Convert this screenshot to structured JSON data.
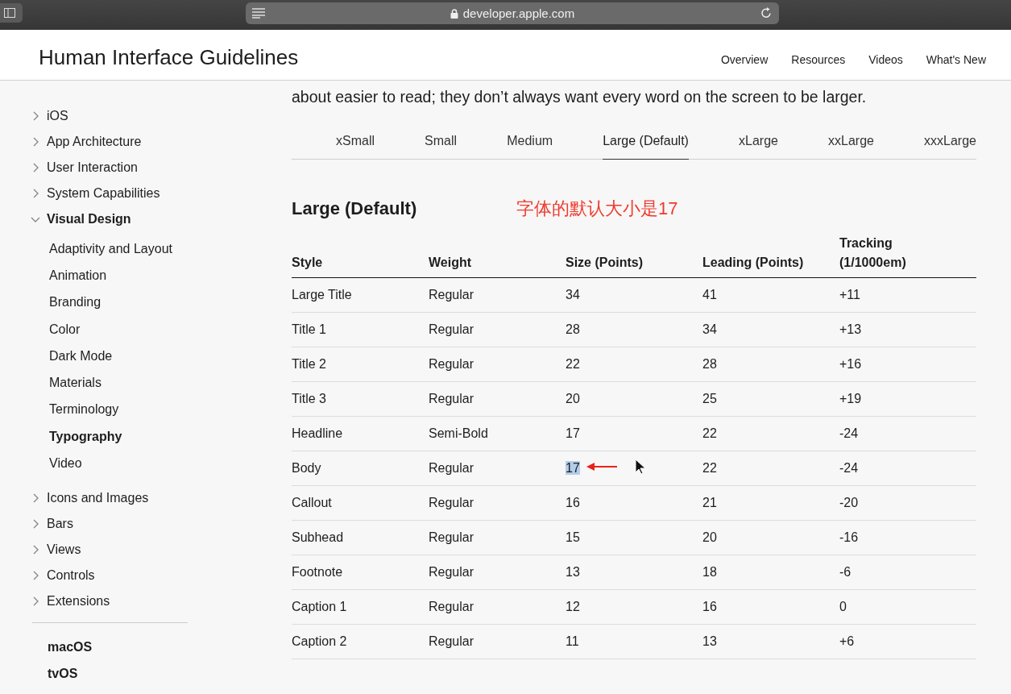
{
  "browser": {
    "address": "developer.apple.com"
  },
  "header": {
    "title": "Human Interface Guidelines",
    "nav": [
      "Overview",
      "Resources",
      "Videos",
      "What's New"
    ]
  },
  "sidebar": {
    "items": [
      {
        "label": "iOS",
        "expanded": false
      },
      {
        "label": "App Architecture",
        "expanded": false
      },
      {
        "label": "User Interaction",
        "expanded": false
      },
      {
        "label": "System Capabilities",
        "expanded": false
      },
      {
        "label": "Visual Design",
        "expanded": true,
        "children": [
          {
            "label": "Adaptivity and Layout",
            "selected": false
          },
          {
            "label": "Animation",
            "selected": false
          },
          {
            "label": "Branding",
            "selected": false
          },
          {
            "label": "Color",
            "selected": false
          },
          {
            "label": "Dark Mode",
            "selected": false
          },
          {
            "label": "Materials",
            "selected": false
          },
          {
            "label": "Terminology",
            "selected": false
          },
          {
            "label": "Typography",
            "selected": true
          },
          {
            "label": "Video",
            "selected": false
          }
        ]
      },
      {
        "label": "Icons and Images",
        "expanded": false
      },
      {
        "label": "Bars",
        "expanded": false
      },
      {
        "label": "Views",
        "expanded": false
      },
      {
        "label": "Controls",
        "expanded": false
      },
      {
        "label": "Extensions",
        "expanded": false
      }
    ],
    "platforms": [
      "macOS",
      "tvOS"
    ]
  },
  "intro": "about easier to read; they don’t always want every word on the screen to be larger.",
  "tabs": [
    {
      "label": "xSmall",
      "selected": false
    },
    {
      "label": "Small",
      "selected": false
    },
    {
      "label": "Medium",
      "selected": false
    },
    {
      "label": "Large (Default)",
      "selected": true
    },
    {
      "label": "xLarge",
      "selected": false
    },
    {
      "label": "xxLarge",
      "selected": false
    },
    {
      "label": "xxxLarge",
      "selected": false
    }
  ],
  "section_title": "Large (Default)",
  "annotation": "字体的默认大小是17",
  "table": {
    "columns": [
      "Style",
      "Weight",
      "Size (Points)",
      "Leading (Points)",
      "Tracking (1/1000em)"
    ],
    "rows": [
      {
        "cells": [
          "Large Title",
          "Regular",
          "34",
          "41",
          "+11"
        ],
        "size_highlighted": false
      },
      {
        "cells": [
          "Title 1",
          "Regular",
          "28",
          "34",
          "+13"
        ],
        "size_highlighted": false
      },
      {
        "cells": [
          "Title 2",
          "Regular",
          "22",
          "28",
          "+16"
        ],
        "size_highlighted": false
      },
      {
        "cells": [
          "Title 3",
          "Regular",
          "20",
          "25",
          "+19"
        ],
        "size_highlighted": false
      },
      {
        "cells": [
          "Headline",
          "Semi-Bold",
          "17",
          "22",
          "-24"
        ],
        "size_highlighted": false
      },
      {
        "cells": [
          "Body",
          "Regular",
          "17",
          "22",
          "-24"
        ],
        "size_highlighted": true
      },
      {
        "cells": [
          "Callout",
          "Regular",
          "16",
          "21",
          "-20"
        ],
        "size_highlighted": false
      },
      {
        "cells": [
          "Subhead",
          "Regular",
          "15",
          "20",
          "-16"
        ],
        "size_highlighted": false
      },
      {
        "cells": [
          "Footnote",
          "Regular",
          "13",
          "18",
          "-6"
        ],
        "size_highlighted": false
      },
      {
        "cells": [
          "Caption 1",
          "Regular",
          "12",
          "16",
          "0"
        ],
        "size_highlighted": false
      },
      {
        "cells": [
          "Caption 2",
          "Regular",
          "11",
          "13",
          "+6"
        ],
        "size_highlighted": false
      }
    ]
  }
}
